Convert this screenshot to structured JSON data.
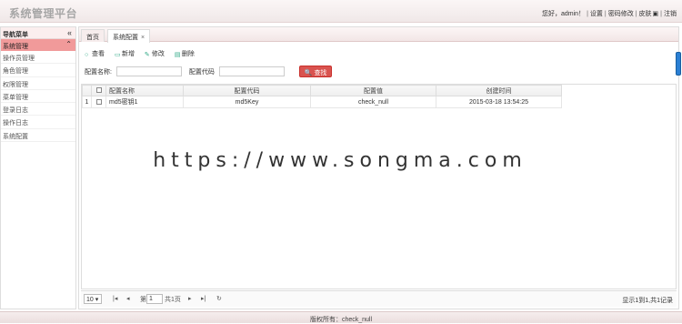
{
  "header": {
    "title": "系统管理平台",
    "links": [
      "您好，admin！",
      "设置",
      "密码修改",
      "皮肤",
      "注销"
    ]
  },
  "sidebar": {
    "title": "导航菜单",
    "group": "系统管理",
    "items": [
      "操作员管理",
      "角色管理",
      "权限管理",
      "菜单管理",
      "登录日志",
      "操作日志",
      "系统配置"
    ]
  },
  "tabs": [
    {
      "label": "首页",
      "active": false
    },
    {
      "label": "系统配置",
      "active": true
    }
  ],
  "toolbar": {
    "view": "查看",
    "add": "新增",
    "edit": "修改",
    "delete": "删除"
  },
  "search": {
    "name_label": "配置名称:",
    "code_label": "配置代码",
    "button": "查找"
  },
  "grid": {
    "columns": [
      "配置名称",
      "配置代码",
      "配置值",
      "创建时间"
    ],
    "rows": [
      {
        "no": "1",
        "name": "md5密钥1",
        "code": "md5Key",
        "value": "check_null",
        "time": "2015-03-18 13:54:25"
      }
    ]
  },
  "pager": {
    "page_size": "10",
    "page_prefix": "第",
    "page_value": "1",
    "page_total": "共1页",
    "info": "显示1到1,共1记录"
  },
  "footer": {
    "text": "版权所有：check_null"
  },
  "watermark": {
    "text": "https://www.songma.com"
  },
  "colors": {
    "accent": "#f19a9a",
    "search_button": "#d9534f",
    "handle": "#2a7fd4"
  }
}
